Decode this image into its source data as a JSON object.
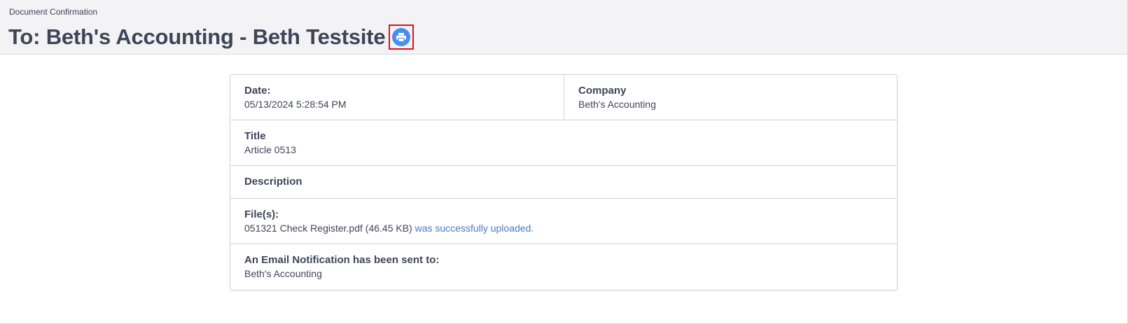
{
  "header": {
    "breadcrumb": "Document Confirmation",
    "title": "To: Beth's Accounting - Beth Testsite",
    "print_icon": "print-icon"
  },
  "details": {
    "date_label": "Date:",
    "date_value": "05/13/2024 5:28:54 PM",
    "company_label": "Company",
    "company_value": "Beth's Accounting",
    "title_label": "Title",
    "title_value": "Article 0513",
    "description_label": "Description",
    "description_value": "",
    "files_label": "File(s):",
    "file_name": "051321 Check Register.pdf (46.45 KB)",
    "file_status": "was successfully uploaded.",
    "notification_label": "An Email Notification has been sent to:",
    "notification_value": "Beth's Accounting"
  },
  "colors": {
    "header_bg": "#f3f3f5",
    "text": "#3d4557",
    "link": "#4a78c9",
    "print_icon_bg": "#4a8df0",
    "highlight_border": "#e0101a"
  }
}
